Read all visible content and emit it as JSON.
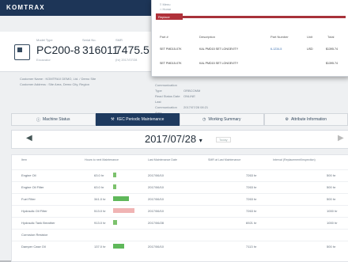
{
  "app": {
    "logo": "KOMTRAX"
  },
  "machine": {
    "model_label": "Model Type",
    "model": "PC200-8",
    "model_sub": "Excavator",
    "serial_label": "Serial No.",
    "serial": "316011",
    "smr_label": "SMR",
    "smr": "7475.5",
    "smr_sub": "(hr) 2017/07/28"
  },
  "info_left": [
    "Customer Name : KOMTRAX DEMO, Ltd. / Demo Site",
    "Customer Address : Site Area, Demo City, Region"
  ],
  "info_right": [
    {
      "k": "Communication Type",
      "v": "ORBCOMM"
    },
    {
      "k": "Read Status Date",
      "v": "ONLINE"
    },
    {
      "k": "Last Communication",
      "v": "2017/07/28 08:21"
    },
    {
      "k": "Area",
      "v": ""
    }
  ],
  "tabs": [
    {
      "icon": "info-icon",
      "label": "Machine Status"
    },
    {
      "icon": "wrench-icon",
      "label": "KEC Periodic Maintenance",
      "active": true
    },
    {
      "icon": "clock-icon",
      "label": "Working Summary"
    },
    {
      "icon": "gear-icon",
      "label": "Attribute Information"
    }
  ],
  "datebar": {
    "prev": "◀",
    "date": "2017/07/28",
    "dropdown": "▾",
    "today": "Today",
    "next": "▶"
  },
  "table": {
    "headers": [
      "Item",
      "Hours to next Maintenance",
      "Last Maintenance Date",
      "SMR at Last Maintenance",
      "Interval (Replacement/Inspection)"
    ],
    "rows": [
      {
        "item": "Engine Oil",
        "hours": "63.0 hr",
        "date": "2017/06/10",
        "smr": "7263 hr",
        "interval": "500 hr",
        "fill": 0.12,
        "color": "#7cc26d"
      },
      {
        "item": "Engine Oil Filter",
        "hours": "63.0 hr",
        "date": "2017/06/10",
        "smr": "7263 hr",
        "interval": "500 hr",
        "fill": 0.12,
        "color": "#7cc26d"
      },
      {
        "item": "Fuel Filter",
        "hours": "341.0 hr",
        "date": "2017/06/10",
        "smr": "7263 hr",
        "interval": "500 hr",
        "fill": 0.68,
        "color": "#5fb85a"
      },
      {
        "item": "Hydraulic Oil Filter",
        "hours": "513.0 hr",
        "date": "2017/06/10",
        "smr": "7263 hr",
        "interval": "1000 hr",
        "fill": 0.9,
        "color": "#f0b4b4"
      },
      {
        "item": "Hydraulic Tank Breather",
        "hours": "913.0 hr",
        "date": "2017/06/28",
        "smr": "6921 hr",
        "interval": "1000 hr",
        "fill": 0.18,
        "color": "#7cc26d"
      },
      {
        "item": "Corrosion Resistor",
        "hours": "",
        "date": "",
        "smr": "",
        "interval": "",
        "fill": 0,
        "color": "#7cc26d"
      },
      {
        "item": "Damper Case Oil",
        "hours": "137.0 hr",
        "date": "2017/06/10",
        "smr": "7113 hr",
        "interval": "500 hr",
        "fill": 0.45,
        "color": "#5fb85a"
      }
    ]
  },
  "overlay": {
    "menu": "≡ Menu",
    "home": "⌂ Home",
    "tab": "Replace",
    "headers": [
      "Part #",
      "Description",
      "Part Number",
      "Unit",
      "Total"
    ],
    "rows": [
      {
        "part": "SET PMD15-07K",
        "desc": "KAL PMD15 SET LONGEVITY",
        "num": "6-1234-5",
        "unit": "USD",
        "total": "$1395.74"
      },
      {
        "part": "SET PMD15-07K",
        "desc": "KAL PMD15 SET LONGEVITY",
        "num": "",
        "unit": "",
        "total": "$1395.74"
      }
    ]
  }
}
